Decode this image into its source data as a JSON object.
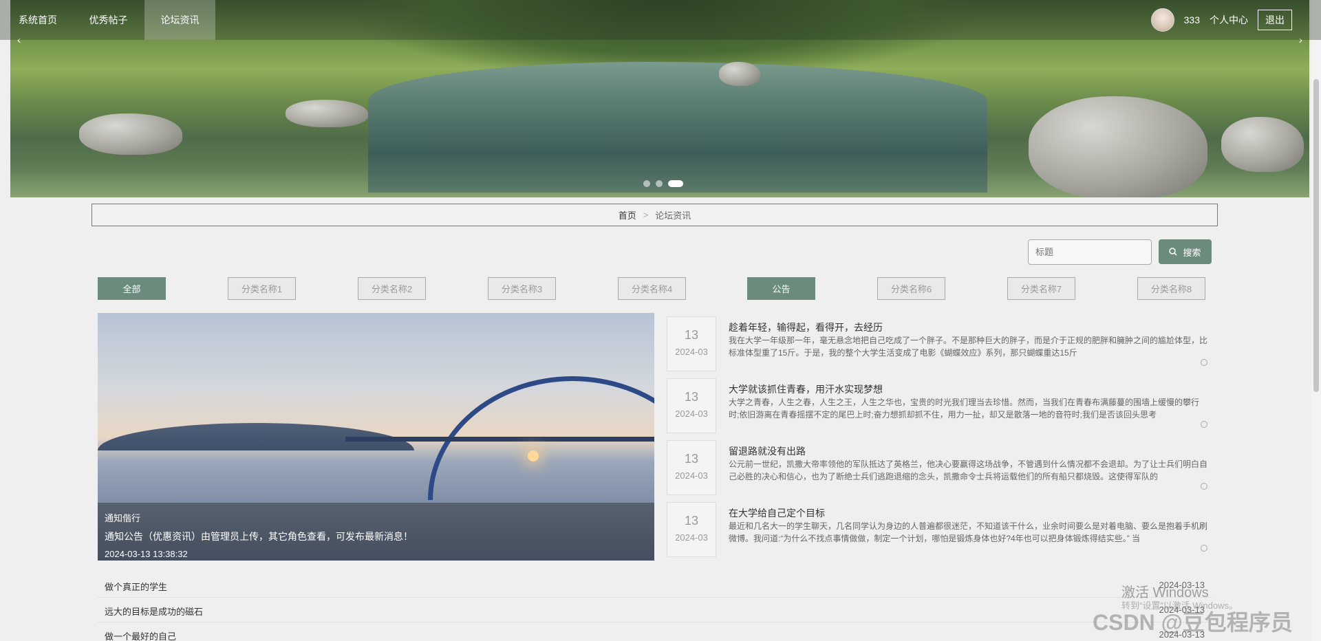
{
  "nav": {
    "items": [
      {
        "label": "系统首页"
      },
      {
        "label": "优秀帖子"
      },
      {
        "label": "论坛资讯"
      }
    ],
    "username": "333",
    "profile_label": "个人中心",
    "logout_label": "退出"
  },
  "banner": {
    "prev_glyph": "‹",
    "next_glyph": "›"
  },
  "breadcrumb": {
    "home": "首页",
    "separator": ">",
    "current": "论坛资讯"
  },
  "search": {
    "placeholder": "标题",
    "button_label": "搜索"
  },
  "categories": [
    {
      "label": "全部",
      "active": true
    },
    {
      "label": "分类名称1"
    },
    {
      "label": "分类名称2"
    },
    {
      "label": "分类名称3"
    },
    {
      "label": "分类名称4"
    },
    {
      "label": "公告",
      "active": true
    },
    {
      "label": "分类名称6"
    },
    {
      "label": "分类名称7"
    },
    {
      "label": "分类名称8"
    }
  ],
  "featured": {
    "category": "通知偕行",
    "title": "通知公告（优惠资讯）由管理员上传，其它角色查看，可发布最新消息！",
    "datetime": "2024-03-13 13:38:32"
  },
  "news": [
    {
      "day": "13",
      "ym": "2024-03",
      "title": "趁着年轻，输得起，看得开，去经历",
      "desc": "我在大学一年级那一年，毫无悬念地把自己吃成了一个胖子。不是那种巨大的胖子，而是介于正规的肥胖和臃肿之间的尴尬体型，比标准体型重了15斤。于是，我的整个大学生活变成了电影《蝴蝶效应》系列，那只蝴蝶重达15斤"
    },
    {
      "day": "13",
      "ym": "2024-03",
      "title": "大学就该抓住青春，用汗水实现梦想",
      "desc": "大学之青春，人生之春，人生之王，人生之华也，宝贵的时光我们理当去珍惜。然而，当我们在青春布满藤蔓的围墙上缓慢的攀行时;依旧游离在青春摇摆不定的尾巴上时;奋力想抓却抓不住，用力一扯，却又是散落一地的音符时;我们是否该回头思考"
    },
    {
      "day": "13",
      "ym": "2024-03",
      "title": "留退路就没有出路",
      "desc": "公元前一世纪，凯撒大帝率领他的军队抵达了英格兰，他决心要赢得这场战争，不管遇到什么情况都不会退却。为了让士兵们明白自己必胜的决心和信心，也为了断绝士兵们逃跑退缩的念头，凯撒命令士兵将运载他们的所有船只都烧毁。这使得军队的"
    },
    {
      "day": "13",
      "ym": "2024-03",
      "title": "在大学给自己定个目标",
      "desc": "最近和几名大一的学生聊天，几名同学认为身边的人普遍都很迷茫，不知道该干什么，业余时间要么是对着电脑、要么是抱着手机刷微博。我问道:“为什么不找点事情做做，制定一个计划，哪怕是锻炼身体也好?4年也可以把身体锻炼得结实些。” 当"
    }
  ],
  "list": [
    {
      "title": "做个真正的学生",
      "date": "2024-03-13"
    },
    {
      "title": "远大的目标是成功的磁石",
      "date": "2024-03-13"
    },
    {
      "title": "做一个最好的自己",
      "date": "2024-03-13"
    }
  ],
  "watermark": {
    "line1": "激活 Windows",
    "line2": "转到“设置”以激活 Windows。",
    "csdn": "CSDN @豆包程序员"
  }
}
